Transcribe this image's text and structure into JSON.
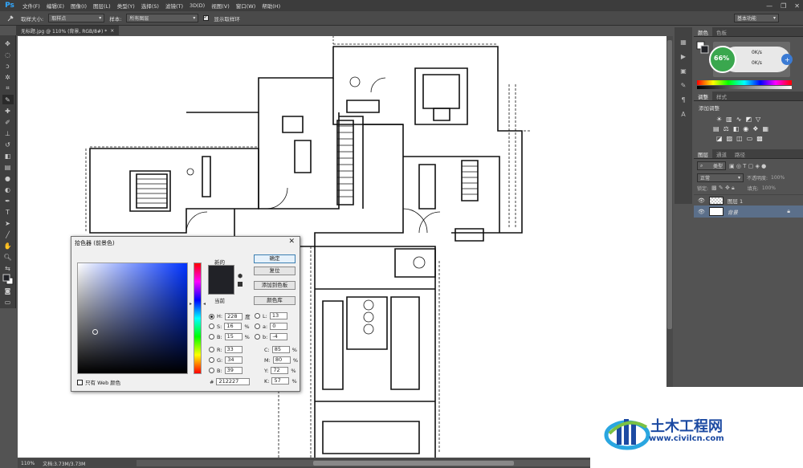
{
  "app": {
    "logo": "Ps",
    "menus": [
      "文件(F)",
      "编辑(E)",
      "图像(I)",
      "图层(L)",
      "类型(Y)",
      "选择(S)",
      "滤镜(T)",
      "3D(D)",
      "视图(V)",
      "窗口(W)",
      "帮助(H)"
    ],
    "window_controls": [
      "—",
      "❐",
      "✕"
    ]
  },
  "options_bar": {
    "sample_size_label": "取样大小:",
    "sample_size_value": "取样点",
    "sample_label": "样本:",
    "sample_value": "所有图层",
    "show_ring_label": "显示取样环",
    "workspace": "基本功能"
  },
  "document": {
    "tab_title": "无标题.jpg @ 110% (背景, RGB/8#) *",
    "zoom": "110%",
    "doc_size": "文档:3.73M/3.73M"
  },
  "panels": {
    "color_tabs": [
      "颜色",
      "色板"
    ],
    "net_percent": "66%",
    "net_up": "0K/s",
    "net_down": "0K/s",
    "adjust_tabs": [
      "调整",
      "样式"
    ],
    "adjust_label": "添加调整",
    "layer_tabs": [
      "图层",
      "通道",
      "路径"
    ],
    "layer_filter": "类型",
    "blend_mode": "正常",
    "opacity_label": "不透明度:",
    "opacity_value": "100%",
    "lock_label": "锁定:",
    "fill_label": "填充:",
    "fill_value": "100%",
    "layers": [
      {
        "name": "图层 1"
      },
      {
        "name": "背景"
      }
    ]
  },
  "picker": {
    "title": "拾色器 (前景色)",
    "new_label": "新的",
    "current_label": "当前",
    "buttons": {
      "ok": "确定",
      "reset": "复位",
      "add_swatch": "添加到色板",
      "library": "颜色库"
    },
    "web_only_label": "只有 Web 颜色",
    "hex_label": "#",
    "hex_value": "212227",
    "swatch_color": "#212227",
    "hsb": [
      {
        "label": "H:",
        "value": "228",
        "unit": "度"
      },
      {
        "label": "S:",
        "value": "16",
        "unit": "%"
      },
      {
        "label": "B:",
        "value": "15",
        "unit": "%"
      }
    ],
    "rgb": [
      {
        "label": "R:",
        "value": "33"
      },
      {
        "label": "G:",
        "value": "34"
      },
      {
        "label": "B:",
        "value": "39"
      }
    ],
    "lab": [
      {
        "label": "L:",
        "value": "13"
      },
      {
        "label": "a:",
        "value": "0"
      },
      {
        "label": "b:",
        "value": "-4"
      }
    ],
    "cmyk": [
      {
        "label": "C:",
        "value": "85",
        "unit": "%"
      },
      {
        "label": "M:",
        "value": "80",
        "unit": "%"
      },
      {
        "label": "Y:",
        "value": "72",
        "unit": "%"
      },
      {
        "label": "K:",
        "value": "57",
        "unit": "%"
      }
    ]
  },
  "watermark": {
    "brand": "土木工程网",
    "url": "www.civilcn.com"
  }
}
